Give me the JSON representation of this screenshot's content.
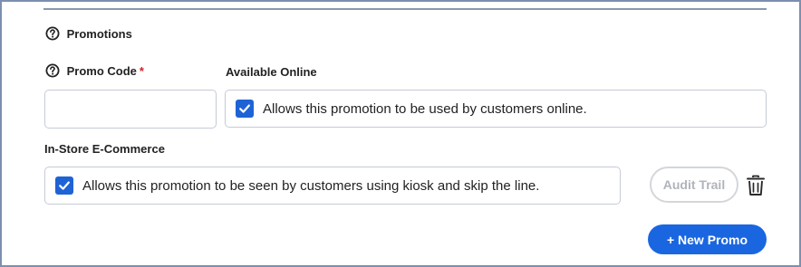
{
  "section": {
    "title": "Promotions"
  },
  "fields": {
    "promo_code": {
      "label": "Promo Code",
      "required_mark": "*",
      "value": ""
    },
    "available_online": {
      "label": "Available Online",
      "checked": true,
      "text": "Allows this promotion to be used by customers online."
    },
    "in_store_ecommerce": {
      "label": "In-Store E-Commerce",
      "checked": true,
      "text": "Allows this promotion to be seen by customers using kiosk and skip the line."
    }
  },
  "actions": {
    "audit_trail": "Audit Trail",
    "new_promo": "+ New Promo"
  },
  "colors": {
    "accent": "#1a66e0",
    "checkbox": "#1e63d6",
    "required": "#d6202a",
    "disabled_text": "#b0b4bb"
  },
  "icons": {
    "help": "question-circle-icon",
    "check": "checkmark-icon",
    "delete": "trash-icon"
  }
}
